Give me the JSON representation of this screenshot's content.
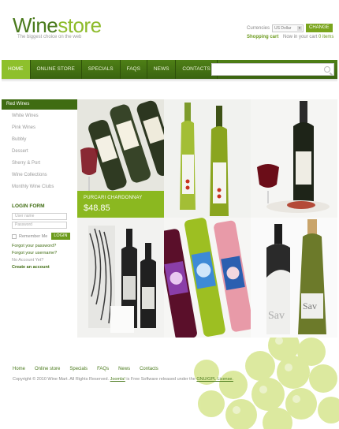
{
  "header": {
    "logo_part1": "Wine",
    "logo_part2": "store",
    "tagline": "The biggest choice on the web",
    "currency_label": "Currencies",
    "currency_value": "US Dollar",
    "change_label": "CHANGE",
    "cart_title": "Shopping cart",
    "cart_text": "Now in your cart",
    "cart_count": "0 items"
  },
  "nav": {
    "items": [
      {
        "label": "Home"
      },
      {
        "label": "Online store"
      },
      {
        "label": "Specials"
      },
      {
        "label": "FAQs"
      },
      {
        "label": "News"
      },
      {
        "label": "Contacts"
      }
    ]
  },
  "sidebar": {
    "categories": [
      "Red Wines",
      "White Wines",
      "Pink Wines",
      "Bubbly",
      "Dessert",
      "Sherry & Port",
      "Wine Collections",
      "Monthly Wine Clubs"
    ],
    "login_title": "LOGIN FORM",
    "username_placeholder": "User name",
    "password_placeholder": "Password",
    "remember_label": "Remember Me",
    "login_button": "LOGIN",
    "forgot_password": "Forgot your password?",
    "forgot_username": "Forgot your username?",
    "no_account": "No Account Yet?",
    "create_account": "Create an account"
  },
  "featured": {
    "title": "PURCARI CHARDONNAY",
    "price": "$48.85"
  },
  "footer": {
    "links": [
      "Home",
      "Online store",
      "Specials",
      "FAQs",
      "News",
      "Contacts"
    ],
    "copyright_prefix": "Copyright © 2010 Wine Mart. All Rights Reserved.",
    "joomla": "Joomla!",
    "copyright_mid": "is Free Software released under the",
    "license": "GNU/GPL License."
  },
  "colors": {
    "brand_dark": "#3f6c12",
    "brand_light": "#8dbb2a",
    "nav_bg": "#4e7f16"
  }
}
